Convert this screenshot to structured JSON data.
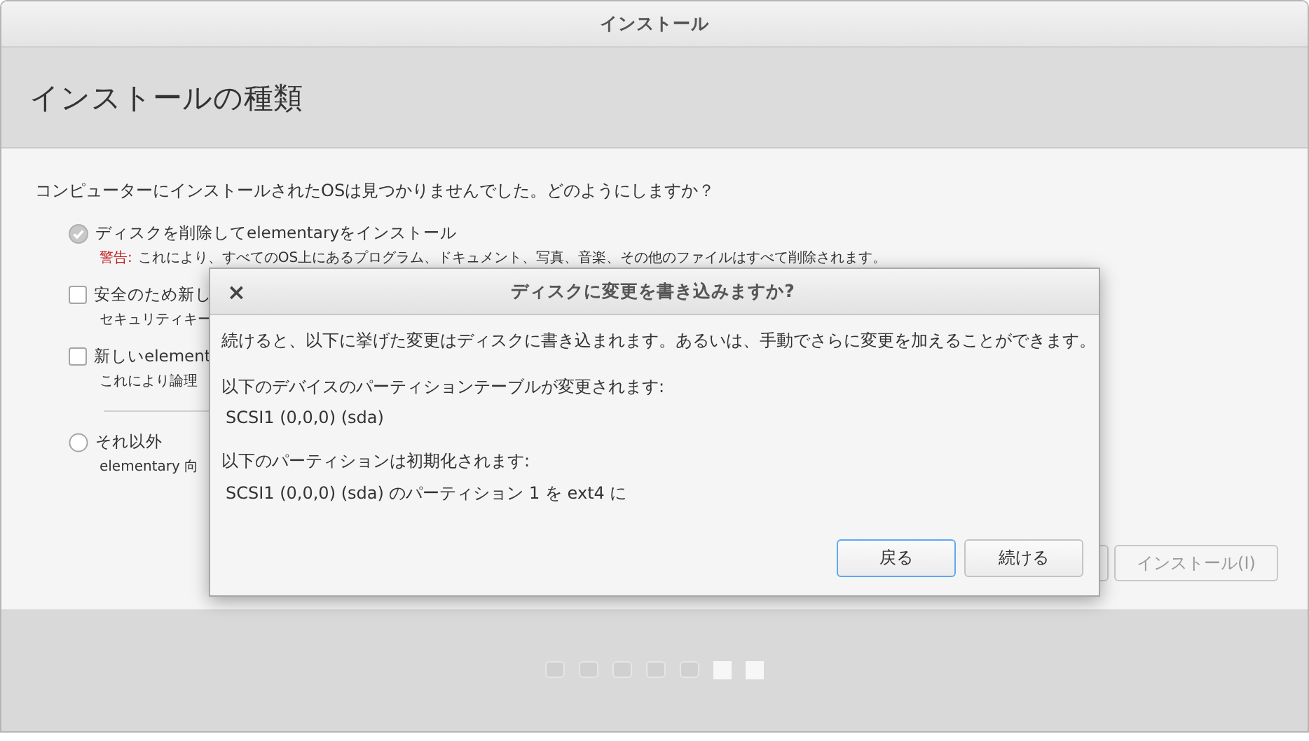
{
  "window": {
    "title": "インストール"
  },
  "header": {
    "title": "インストールの種類"
  },
  "question": "コンピューターにインストールされたOSは見つかりませんでした。どのようにしますか？",
  "options": [
    {
      "kind": "radio",
      "label": "ディスクを削除してelementaryをインストール",
      "selected": true,
      "warning_label": "警告:",
      "note": "これにより、すべてのOS上にあるプログラム、ドキュメント、写真、音楽、その他のファイルはすべて削除されます。"
    },
    {
      "kind": "checkbox",
      "label": "安全のため新し",
      "checked": false,
      "note": "セキュリティキー"
    },
    {
      "kind": "checkbox",
      "label": "新しいelement",
      "checked": false,
      "note": "これにより論理"
    },
    {
      "kind": "radio",
      "label": "それ以外",
      "selected": false,
      "separator": true,
      "note": "elementary 向"
    }
  ],
  "buttons": [
    {
      "kind": "blank"
    },
    {
      "kind": "text",
      "label": "インストール(I)",
      "disabled": true
    }
  ],
  "steps": [
    {
      "filled": false
    },
    {
      "filled": false
    },
    {
      "filled": false
    },
    {
      "filled": false
    },
    {
      "filled": false
    },
    {
      "filled": true
    },
    {
      "filled": true
    }
  ],
  "dialog": {
    "close": "×",
    "title": "ディスクに変更を書き込みますか?",
    "paragraphs": [
      {
        "lines": [
          "続けると、以下に挙げた変更はディスクに書き込まれます。あるいは、手動でさらに変更を加えることができます。"
        ]
      },
      {
        "lines": [
          "以下のデバイスのパーティションテーブルが変更されます:",
          "SCSI1 (0,0,0) (sda)"
        ]
      },
      {
        "lines": [
          "以下のパーティションは初期化されます:",
          "SCSI1 (0,0,0) (sda) のパーティション 1 を ext4 に"
        ]
      }
    ],
    "buttons": [
      {
        "label": "戻る",
        "focused": true
      },
      {
        "label": "続ける",
        "focused": false
      }
    ]
  }
}
